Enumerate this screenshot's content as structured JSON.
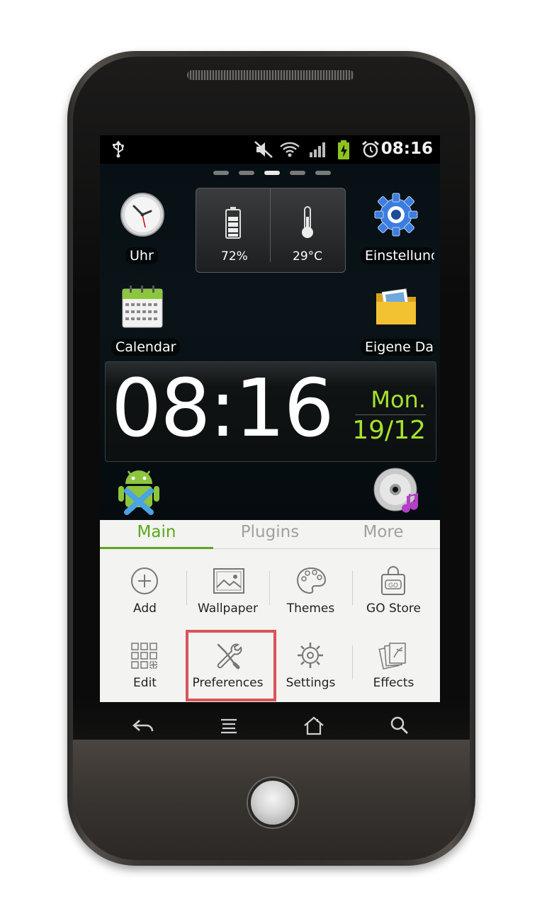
{
  "status_bar": {
    "time": "08:16",
    "icons": [
      "usb-icon",
      "mute-icon",
      "wifi-icon",
      "signal-icon",
      "battery-charging-icon",
      "alarm-icon"
    ]
  },
  "home": {
    "page_count": 5,
    "active_page": 3,
    "apps": {
      "uhr": "Uhr",
      "einstellungen": "Einstellung",
      "calendar": "Calendar",
      "eigene_dateien": "Eigene Date"
    },
    "widget": {
      "battery": "72%",
      "temperature": "29°C"
    },
    "clock": {
      "time": "08:16",
      "day": "Mon.",
      "date": "19/12"
    }
  },
  "menu": {
    "tabs": [
      "Main",
      "Plugins",
      "More"
    ],
    "active_tab": "Main",
    "items": {
      "add": "Add",
      "wallpaper": "Wallpaper",
      "themes": "Themes",
      "go_store": "GO Store",
      "edit": "Edit",
      "preferences": "Preferences",
      "settings": "Settings",
      "effects": "Effects"
    },
    "highlighted_item": "Preferences"
  },
  "colors": {
    "accent_green": "#5aa81d",
    "clock_green": "#a6e22e",
    "highlight_red": "#d9545a"
  }
}
